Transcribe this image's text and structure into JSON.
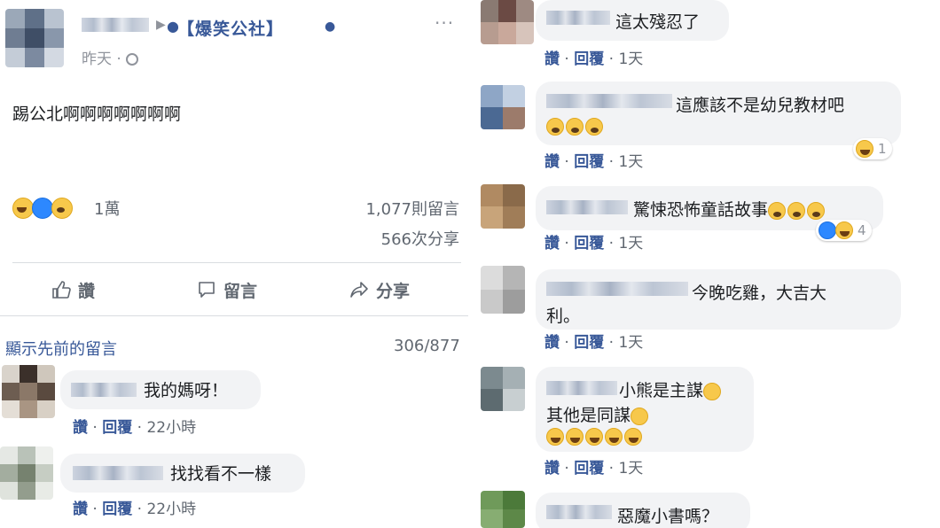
{
  "post": {
    "group_name": "【爆笑公社】",
    "time": "昨天 · ",
    "text": "踢公北啊啊啊啊啊啊啊",
    "more": "···",
    "reaction_count": "1萬",
    "comments_stat": "1,077則留言",
    "shares_stat": "566次分享"
  },
  "actions": {
    "like": "讚",
    "comment": "留言",
    "share": "分享"
  },
  "comments_header": {
    "show_previous": "顯示先前的留言",
    "pager": "306/877"
  },
  "meta_labels": {
    "like": "讚",
    "reply": "回覆"
  },
  "comments_left": [
    {
      "text": "我的媽呀！",
      "time": "22小時"
    },
    {
      "text": "找找看不一樣",
      "time": "22小時"
    }
  ],
  "comments_right": [
    {
      "text": "這太殘忍了",
      "time": "1天"
    },
    {
      "text": "這應該不是幼兒教材吧",
      "time": "1天",
      "reactions": "1"
    },
    {
      "text": "驚悚恐怖童話故事",
      "time": "1天",
      "reactions": "4"
    },
    {
      "line1": "今晚吃雞，大吉大",
      "line2": "利。",
      "time": "1天"
    },
    {
      "line1": "小熊是主謀",
      "line2": "其他是同謀",
      "time": "1天"
    },
    {
      "text": "惡魔小書嗎？"
    }
  ],
  "colors": {
    "link": "#385898",
    "meta": "#606770",
    "bubble": "#f2f3f5"
  }
}
